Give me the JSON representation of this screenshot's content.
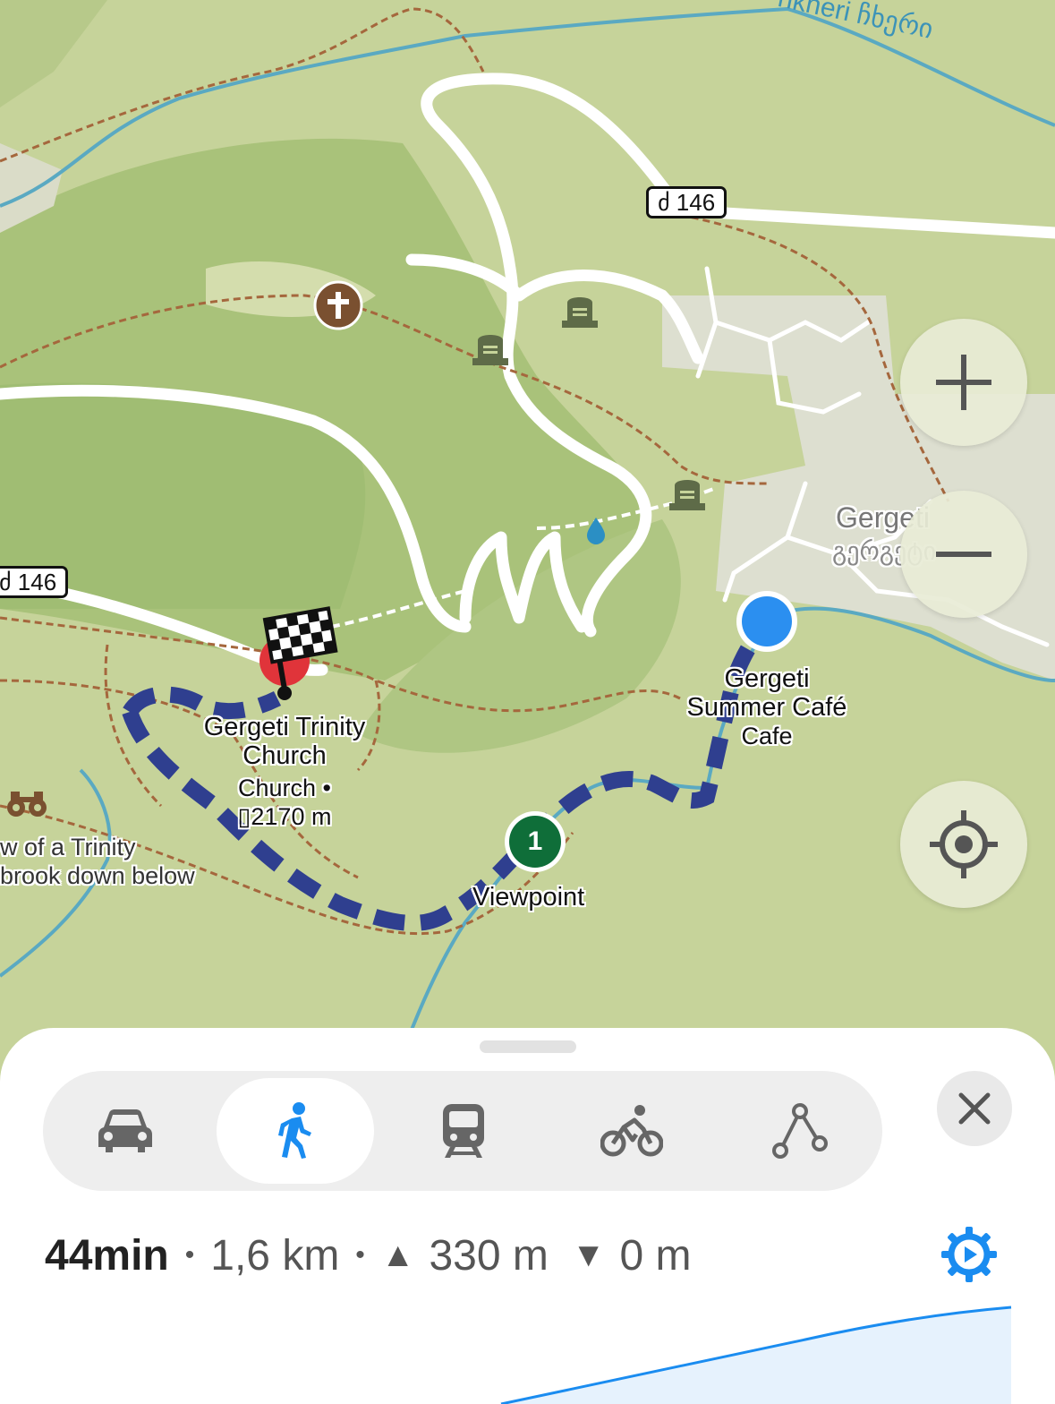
{
  "map": {
    "road_shields": [
      "ძ 146",
      "ძ 146"
    ],
    "labels": {
      "river": "hkheri ჩხერი",
      "village_en": "Gergeti",
      "village_ka": "გერგეტი",
      "poi_destination": [
        "Gergeti Trinity",
        "Church"
      ],
      "poi_destination_sub": [
        "Church •",
        "▯2170 m"
      ],
      "poi_cafe": [
        "Gergeti",
        "Summer Café",
        "Cafe"
      ],
      "waypoint_number": "1",
      "waypoint_label": "Viewpoint",
      "viewpoint_text": [
        "w of a Trinity",
        "brook down below"
      ]
    },
    "colors": {
      "route": "#2f3f8f",
      "current_location": "#2b8ff0",
      "waypoint": "#0f6e39",
      "destination": "#e0343a"
    }
  },
  "controls": {
    "zoom_in": "zoom-in",
    "zoom_out": "zoom-out",
    "locate": "my-location"
  },
  "sheet": {
    "modes": [
      {
        "name": "car",
        "active": false
      },
      {
        "name": "walk",
        "active": true
      },
      {
        "name": "transit",
        "active": false
      },
      {
        "name": "bike",
        "active": false
      },
      {
        "name": "route-planner",
        "active": false
      }
    ],
    "summary": {
      "time": "44min",
      "bullet1": "•",
      "distance": "1,6 km",
      "bullet2": "•",
      "ascent_icon": "▲",
      "ascent": "330 m",
      "descent_icon": "▼",
      "descent": "0 m"
    },
    "accent": "#1a8cf0"
  }
}
